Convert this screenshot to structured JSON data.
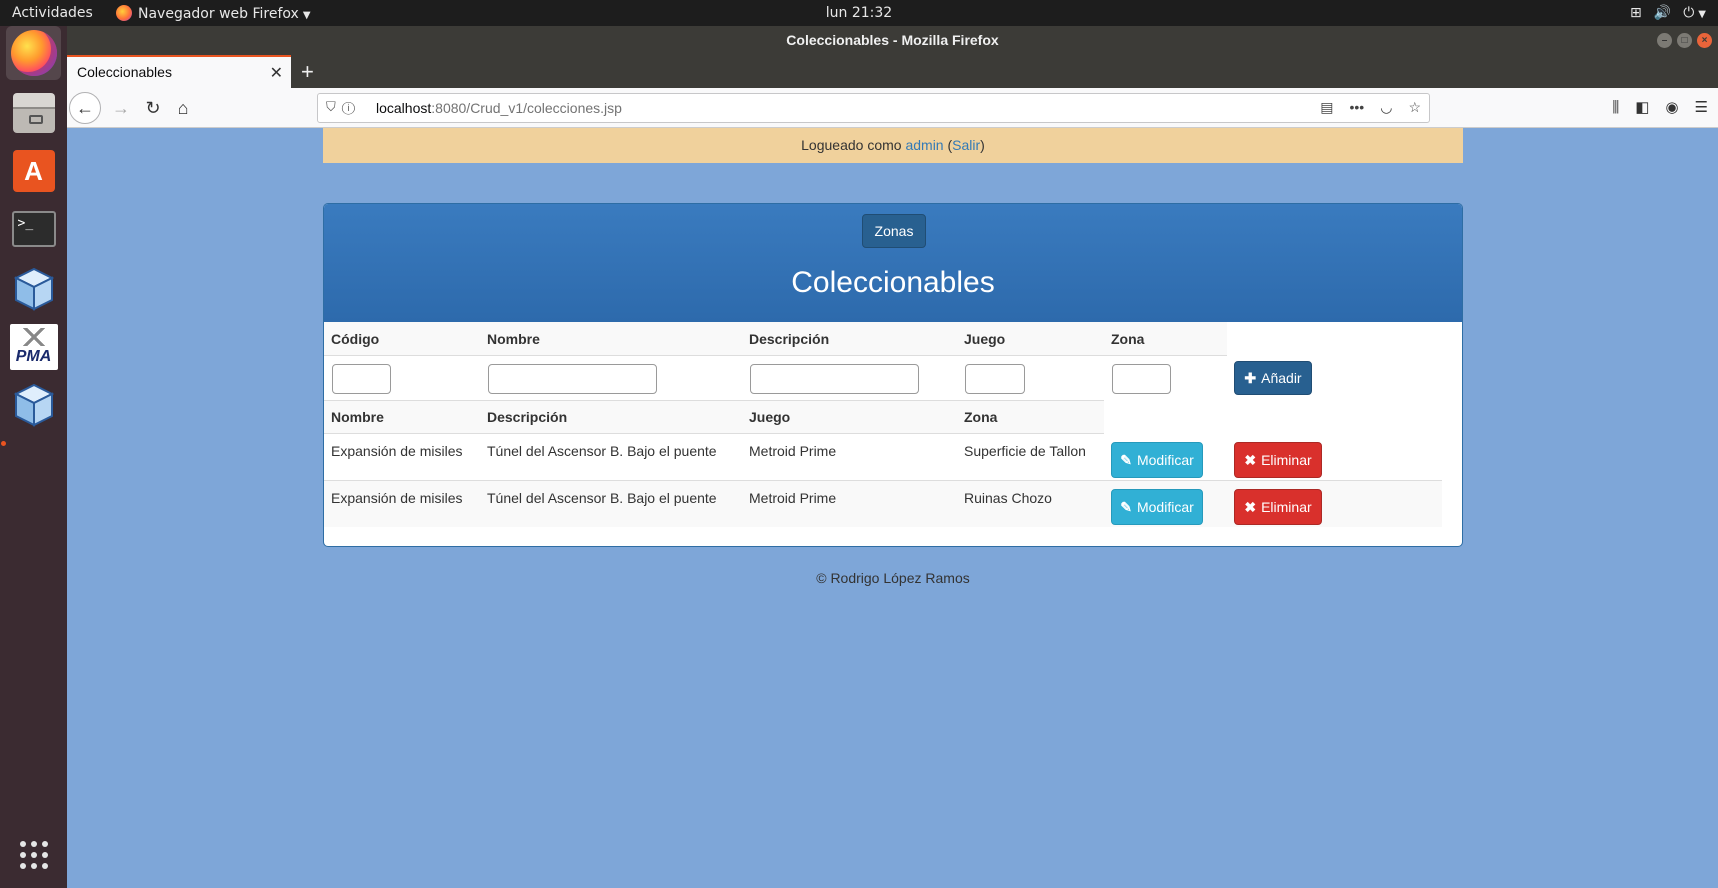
{
  "system": {
    "activities": "Actividades",
    "app_name": "Navegador web Firefox",
    "clock": "lun 21:32"
  },
  "window": {
    "title": "Coleccionables - Mozilla Firefox",
    "tab_title": "Coleccionables",
    "url_host": "localhost",
    "url_rest": ":8080/Crud_v1/colecciones.jsp"
  },
  "page": {
    "login_prefix": "Logueado como ",
    "login_user": "admin",
    "login_open": " (",
    "login_logout": "Salir",
    "login_close": ")",
    "zonas_button": "Zonas",
    "title": "Coleccionables",
    "form_headers": [
      "Código",
      "Nombre",
      "Descripción",
      "Juego",
      "Zona"
    ],
    "add_button": "Añadir",
    "list_headers": [
      "Nombre",
      "Descripción",
      "Juego",
      "Zona"
    ],
    "rows": [
      {
        "nombre": "Expansión de misiles",
        "descripcion": "Túnel del Ascensor B. Bajo el puente",
        "juego": "Metroid Prime",
        "zona": "Superficie de Tallon"
      },
      {
        "nombre": "Expansión de misiles",
        "descripcion": "Túnel del Ascensor B. Bajo el puente",
        "juego": "Metroid Prime",
        "zona": "Ruinas Chozo"
      }
    ],
    "modify_button": "Modificar",
    "delete_button": "Eliminar",
    "footer": "© Rodrigo López Ramos"
  },
  "colors": {
    "page_bg": "#7ea6d8",
    "panel_head": "#337ab7",
    "login_bg": "#f0d19c",
    "btn_info": "#31b0d5",
    "btn_danger": "#d9302c"
  }
}
